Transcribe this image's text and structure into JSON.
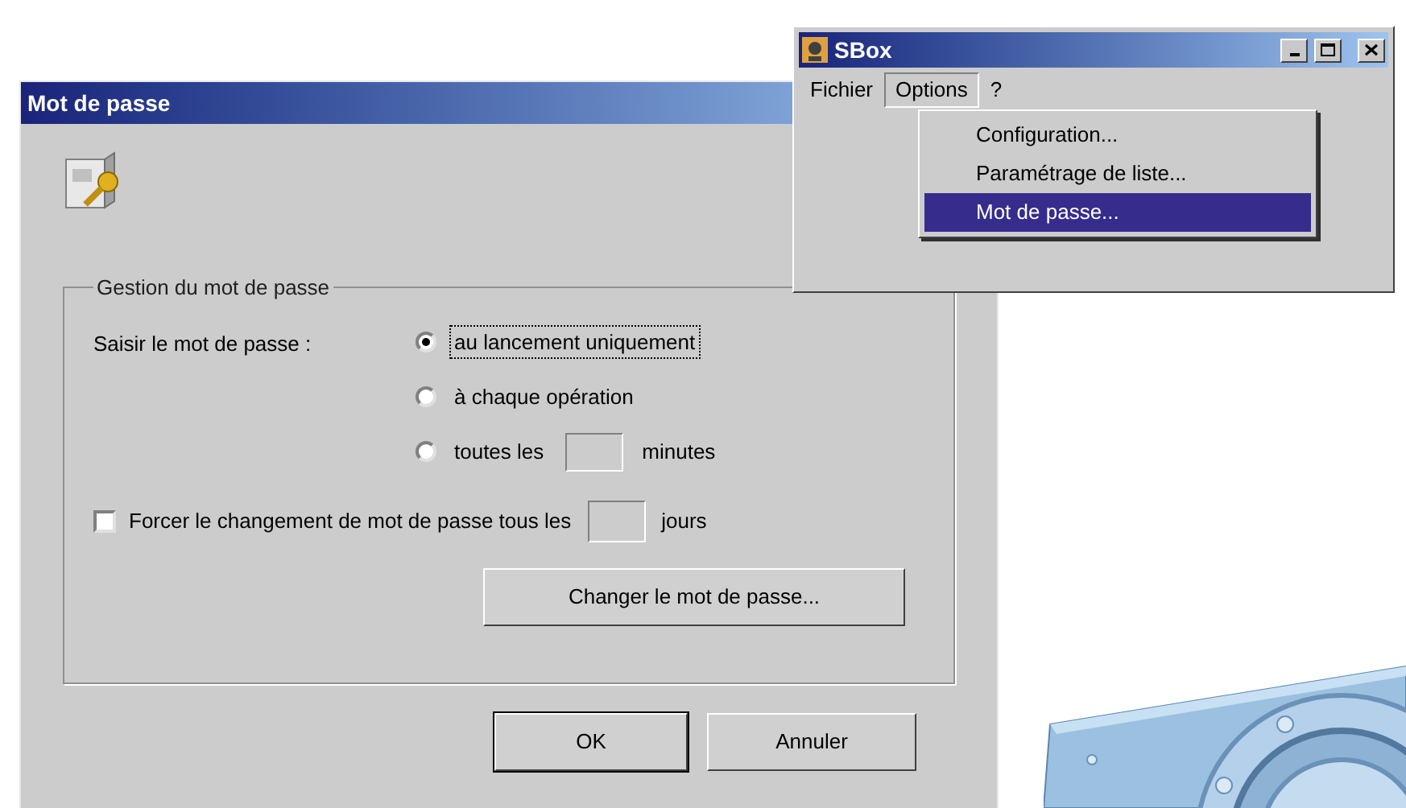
{
  "dialog": {
    "title": "Mot de passe",
    "group": {
      "legend": "Gestion du mot de passe",
      "prompt_label": "Saisir le mot de passe :",
      "options": [
        {
          "label": "au lancement uniquement",
          "selected": true,
          "kind": "plain"
        },
        {
          "label": "à chaque opération",
          "selected": false,
          "kind": "plain"
        },
        {
          "label": "toutes les",
          "suffix": "minutes",
          "selected": false,
          "kind": "field"
        }
      ],
      "force_change": {
        "label": "Forcer le changement de mot de passe tous les",
        "suffix": "jours",
        "checked": false
      },
      "change_button": "Changer le mot de passe..."
    },
    "buttons": [
      "OK",
      "Annuler"
    ]
  },
  "sbox_window": {
    "title": "SBox",
    "menu": [
      {
        "label": "Fichier",
        "selected": false
      },
      {
        "label": "Options",
        "selected": true
      },
      {
        "label": "?",
        "selected": false
      }
    ],
    "dropdown": [
      {
        "label": "Configuration...",
        "selected": false
      },
      {
        "label": "Paramétrage de liste...",
        "selected": false
      },
      {
        "label": "Mot de passe...",
        "selected": true
      }
    ]
  }
}
